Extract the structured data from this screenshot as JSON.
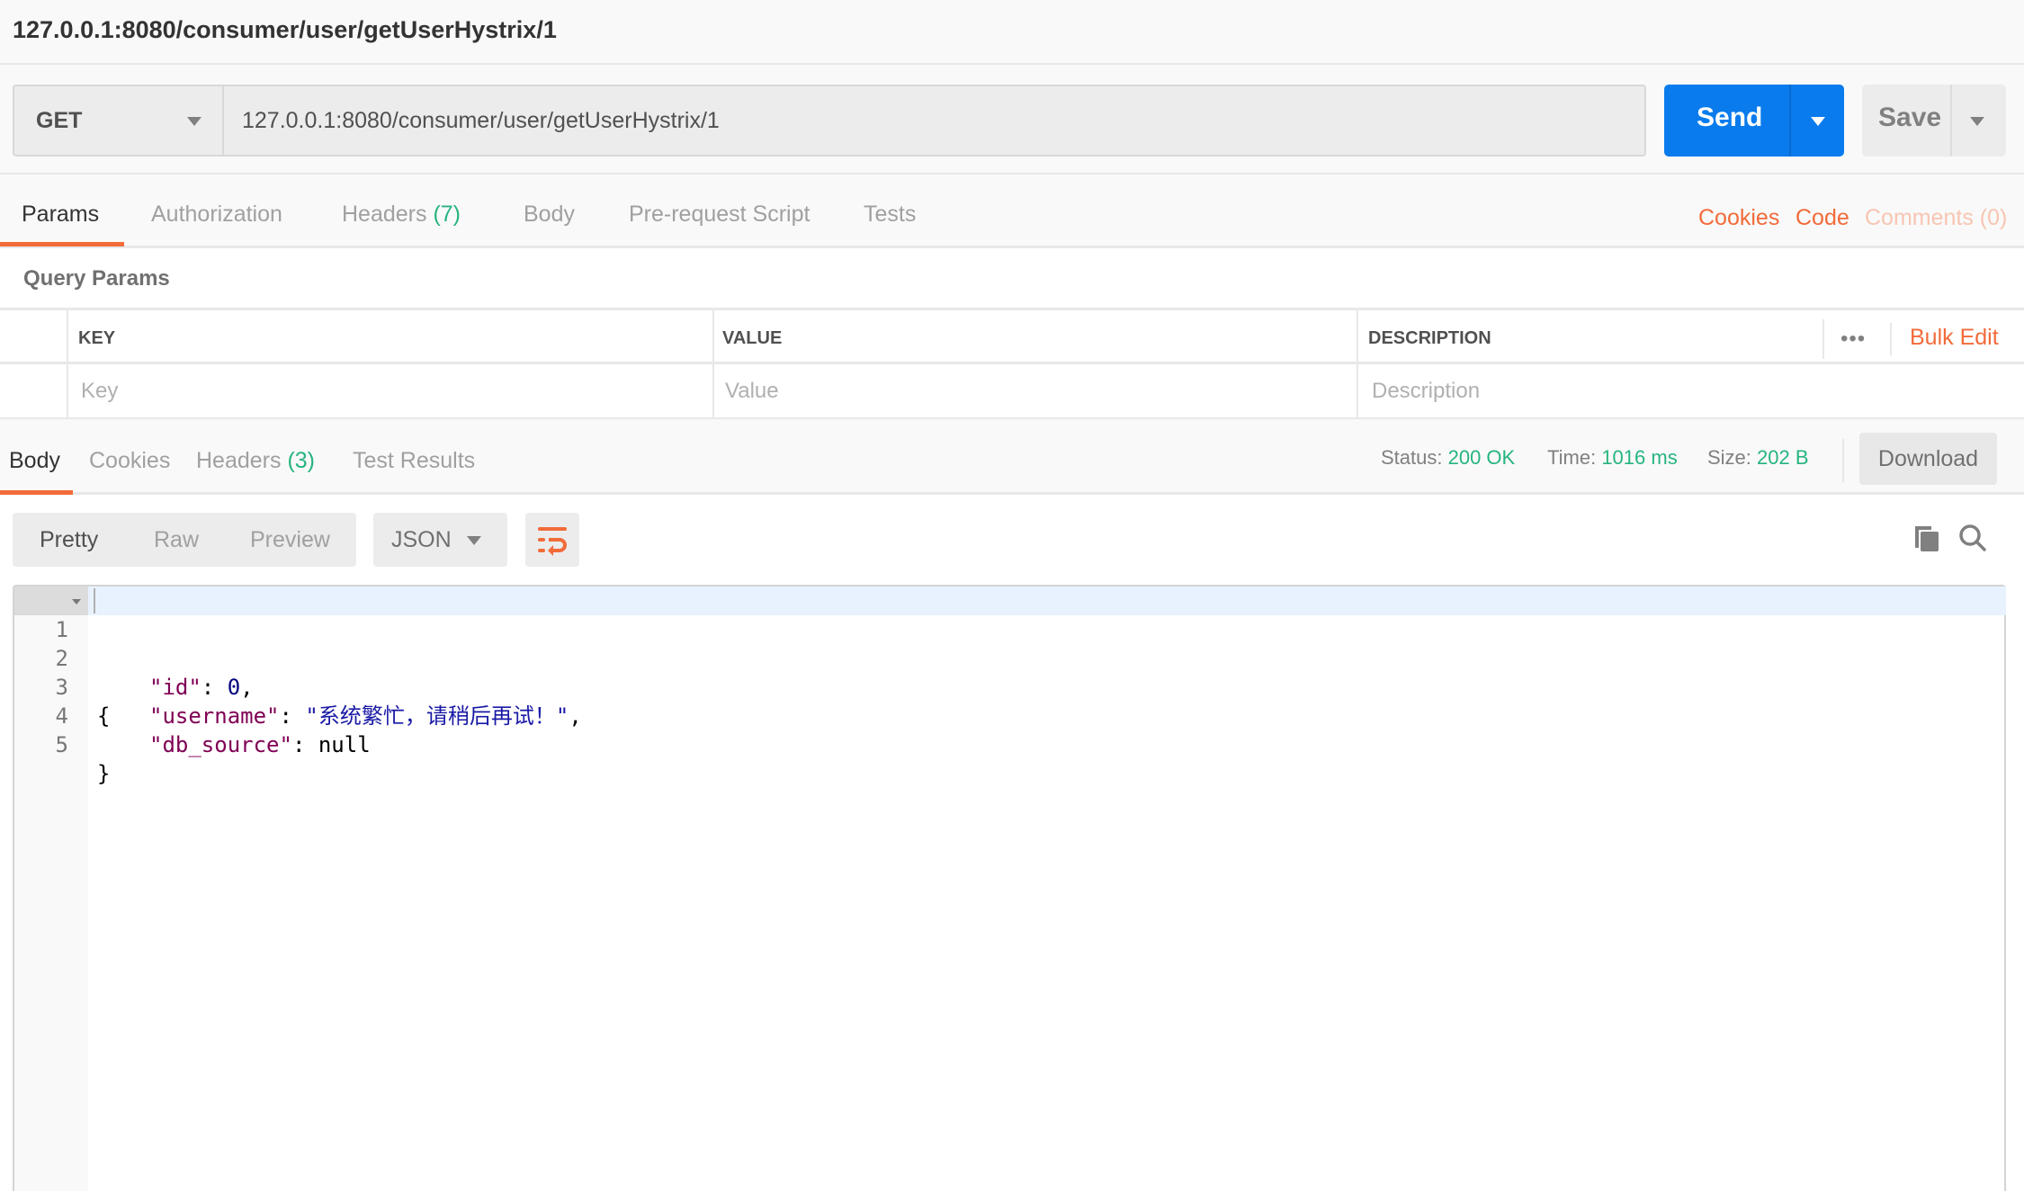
{
  "window": {
    "title": "127.0.0.1:8080/consumer/user/getUserHystrix/1"
  },
  "request": {
    "method": "GET",
    "url": "127.0.0.1:8080/consumer/user/getUserHystrix/1",
    "send_label": "Send",
    "save_label": "Save"
  },
  "request_tabs": [
    {
      "label": "Params",
      "count": null,
      "active": true
    },
    {
      "label": "Authorization",
      "count": null,
      "active": false
    },
    {
      "label": "Headers",
      "count": "(7)",
      "active": false
    },
    {
      "label": "Body",
      "count": null,
      "active": false
    },
    {
      "label": "Pre-request Script",
      "count": null,
      "active": false
    },
    {
      "label": "Tests",
      "count": null,
      "active": false
    }
  ],
  "request_links": {
    "cookies": "Cookies",
    "code": "Code",
    "comments": "Comments (0)"
  },
  "query_params": {
    "title": "Query Params",
    "columns": [
      "KEY",
      "VALUE",
      "DESCRIPTION"
    ],
    "placeholders": {
      "key": "Key",
      "value": "Value",
      "description": "Description"
    },
    "bulk_edit": "Bulk Edit",
    "more": "•••"
  },
  "response_tabs": [
    {
      "label": "Body",
      "count": null,
      "active": true
    },
    {
      "label": "Cookies",
      "count": null,
      "active": false
    },
    {
      "label": "Headers",
      "count": "(3)",
      "active": false
    },
    {
      "label": "Test Results",
      "count": null,
      "active": false
    }
  ],
  "response_meta": {
    "status_label": "Status:",
    "status_value": "200 OK",
    "time_label": "Time:",
    "time_value": "1016 ms",
    "size_label": "Size:",
    "size_value": "202 B",
    "download": "Download"
  },
  "view_modes": [
    {
      "label": "Pretty",
      "active": true
    },
    {
      "label": "Raw",
      "active": false
    },
    {
      "label": "Preview",
      "active": false
    }
  ],
  "format": "JSON",
  "response_body": {
    "line_numbers": [
      "1",
      "2",
      "3",
      "4",
      "5"
    ],
    "open_brace": "{",
    "close_brace": "}",
    "fields": [
      {
        "key": "\"id\"",
        "value": "0",
        "type": "number",
        "trailing": ","
      },
      {
        "key": "\"username\"",
        "value": "\"系统繁忙，请稍后再试！\"",
        "type": "string",
        "trailing": ","
      },
      {
        "key": "\"db_source\"",
        "value": "null",
        "type": "null",
        "trailing": ""
      }
    ]
  },
  "colors": {
    "accent_orange": "#f26b3a",
    "send_blue": "#097bed",
    "success_green": "#26b47f"
  }
}
